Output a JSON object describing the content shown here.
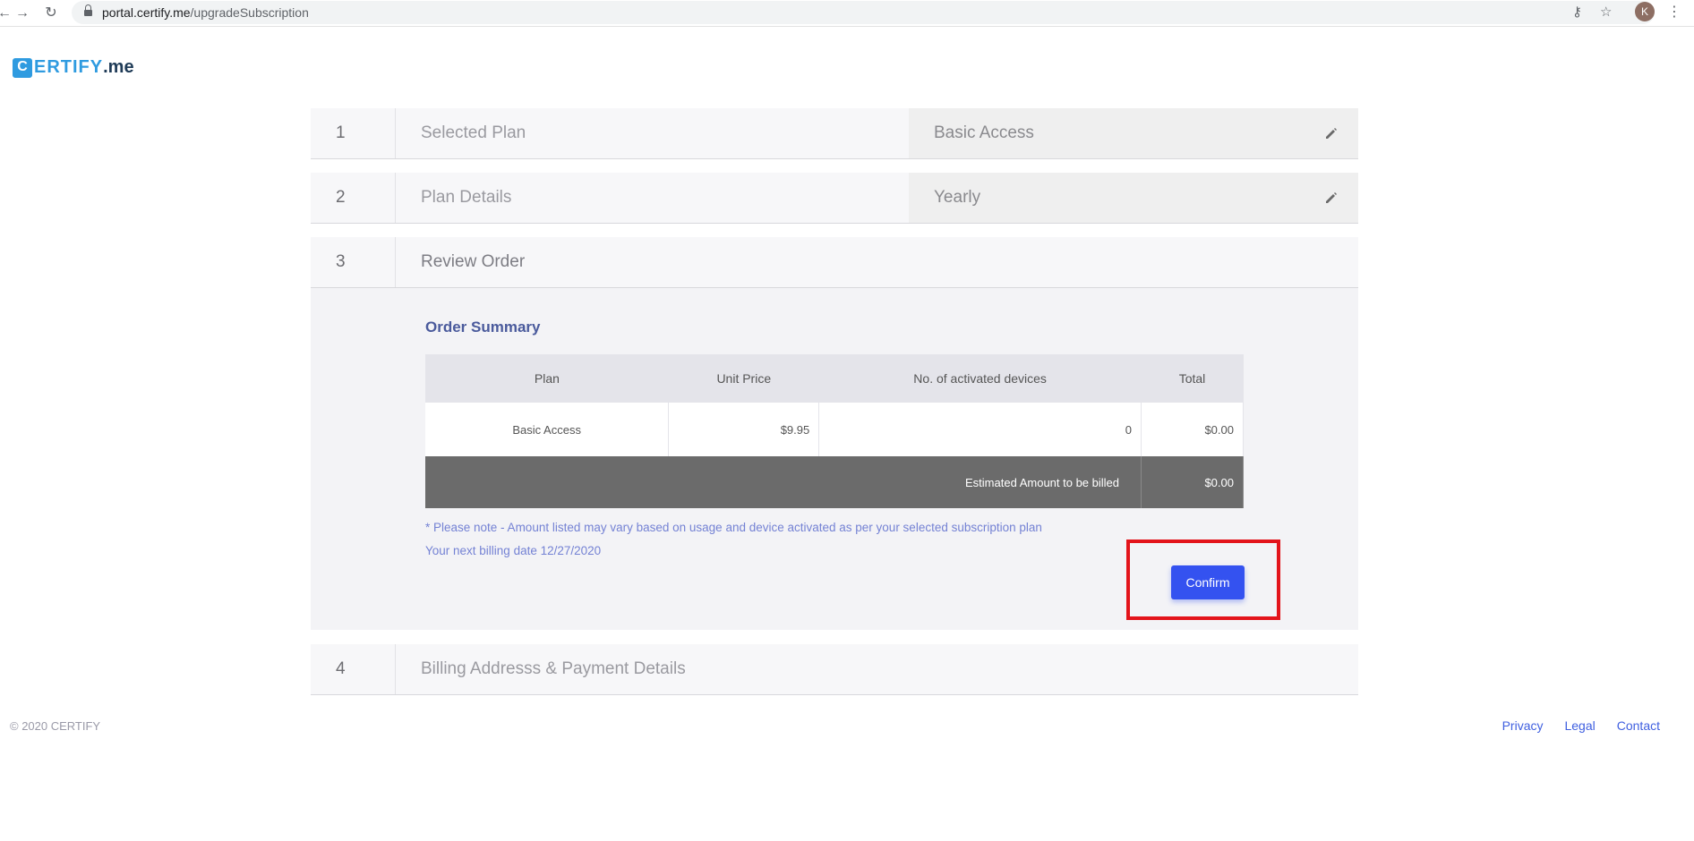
{
  "browser": {
    "url_host": "portal.certify.me",
    "url_path": "/upgradeSubscription",
    "profile_initial": "K"
  },
  "logo": {
    "box_letter": "C",
    "text": "ERTIFY",
    "suffix": ".me"
  },
  "steps": [
    {
      "number": "1",
      "title": "Selected Plan",
      "value": "Basic Access"
    },
    {
      "number": "2",
      "title": "Plan Details",
      "value": "Yearly"
    },
    {
      "number": "3",
      "title": "Review Order"
    },
    {
      "number": "4",
      "title": "Billing Addresss & Payment Details"
    }
  ],
  "order_summary": {
    "title": "Order Summary",
    "columns": [
      "Plan",
      "Unit Price",
      "No. of activated devices",
      "Total"
    ],
    "row": {
      "plan": "Basic Access",
      "unit_price": "$9.95",
      "devices": "0",
      "total": "$0.00"
    },
    "estimated_label": "Estimated Amount to be billed",
    "estimated_total": "$0.00",
    "note": "* Please note - Amount listed may vary based on usage and device activated as per your selected subscription plan",
    "next_billing": "Your next billing date 12/27/2020",
    "confirm_label": "Confirm"
  },
  "footer": {
    "copyright": "© 2020 CERTIFY",
    "links": [
      "Privacy",
      "Legal",
      "Contact"
    ]
  },
  "colors": {
    "accent": "#3452f0",
    "logo_blue": "#2f9be0",
    "highlight_red": "#e3141b"
  }
}
